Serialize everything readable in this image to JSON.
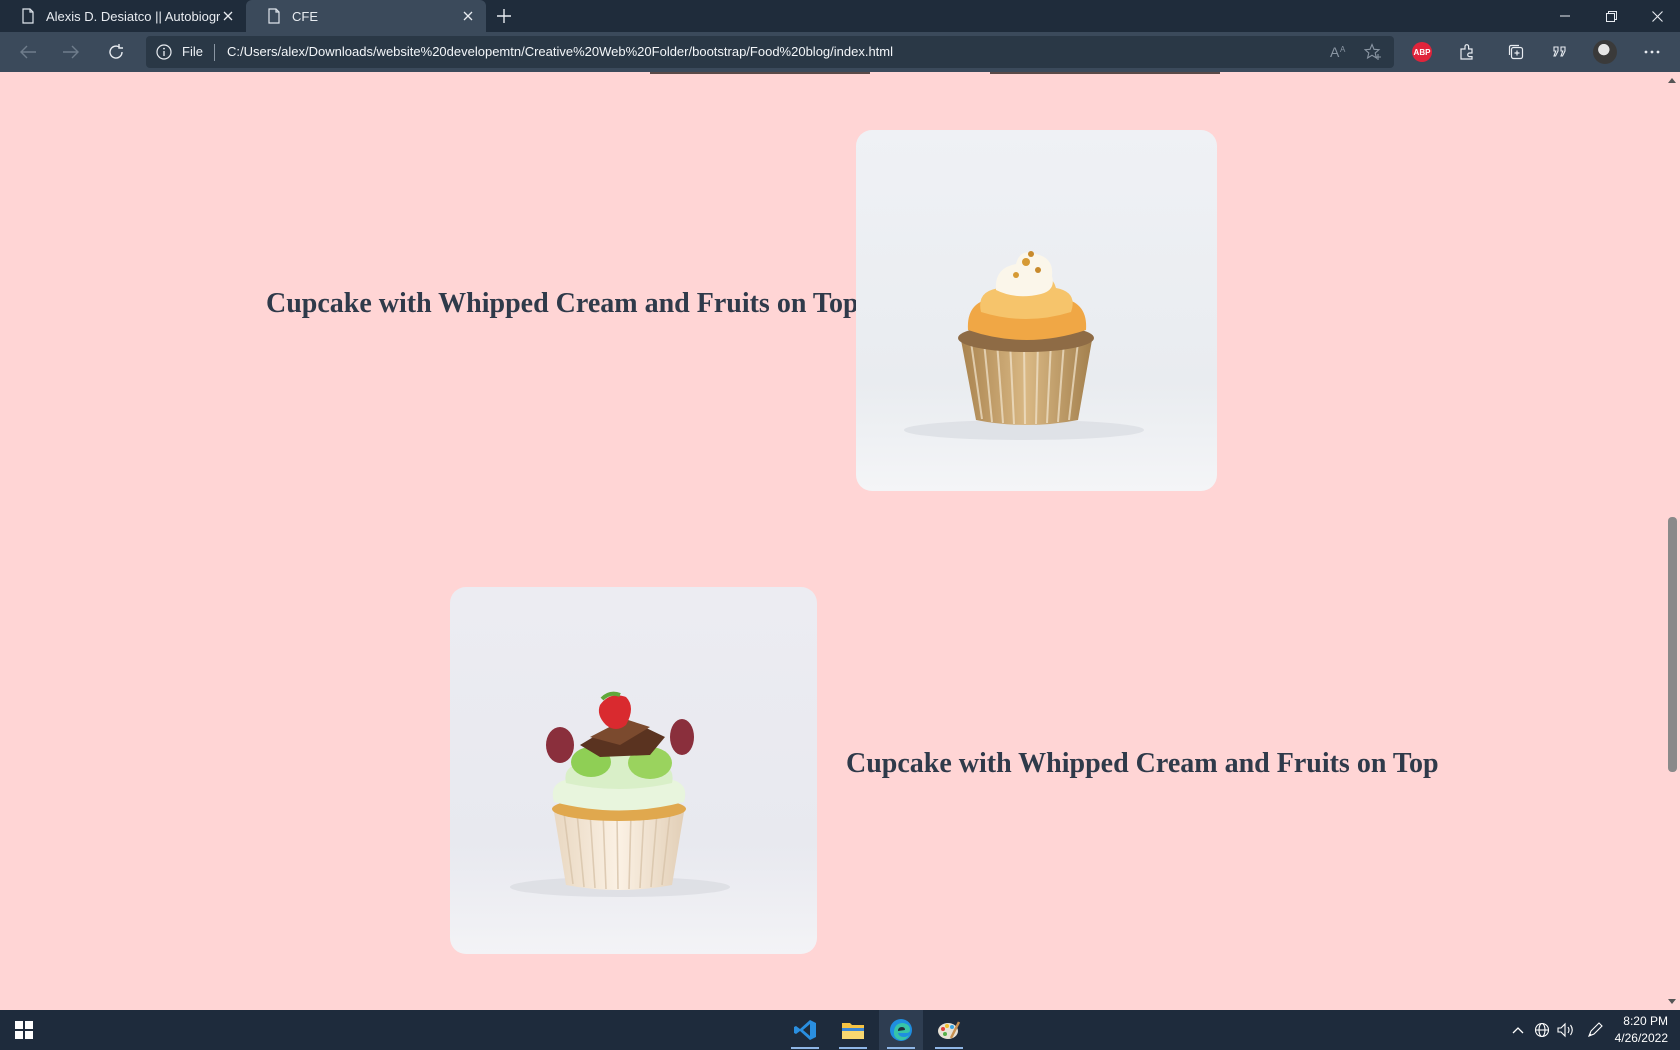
{
  "browser": {
    "tabs": [
      {
        "title": "Alexis D. Desiatco || Autobiography",
        "active": false
      },
      {
        "title": "CFE",
        "active": true
      }
    ],
    "address": {
      "scheme_label": "File",
      "url": "C:/Users/alex/Downloads/website%20developemtn/Creative%20Web%20Folder/bootstrap/Food%20blog/index.html"
    },
    "toolbar_icons": [
      "read-aloud-icon",
      "favorite-icon",
      "adblock-plus-icon",
      "extensions-icon",
      "collections-icon",
      "quote-icon",
      "profile-avatar",
      "more-icon"
    ],
    "abp_label": "ABP"
  },
  "page": {
    "background": "#ffd5d5",
    "sections": [
      {
        "caption": "Cupcake with Whipped Cream and Fruits on Top",
        "image": "cupcake-orange-frosting"
      },
      {
        "caption": "Cupcake with Whipped Cream and Fruits on Top",
        "image": "cupcake-fruit-topping"
      }
    ]
  },
  "taskbar": {
    "apps": [
      "vscode-icon",
      "file-explorer-icon",
      "edge-icon",
      "paint-icon"
    ],
    "clock": {
      "time": "8:20 PM",
      "date": "4/26/2022"
    }
  }
}
